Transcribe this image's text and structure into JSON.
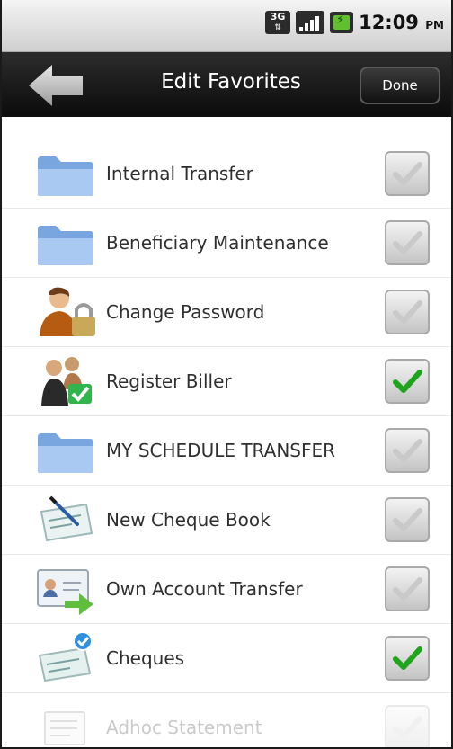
{
  "status": {
    "network": "3G",
    "time": "12:09",
    "ampm": "PM"
  },
  "header": {
    "title": "Edit Favorites",
    "done_label": "Done"
  },
  "items": [
    {
      "label": "Internal Transfer",
      "icon": "folder-icon",
      "checked": false
    },
    {
      "label": "Beneficiary Maintenance",
      "icon": "folder-icon",
      "checked": false
    },
    {
      "label": "Change Password",
      "icon": "user-lock-icon",
      "checked": false
    },
    {
      "label": "Register Biller",
      "icon": "register-biller-icon",
      "checked": true
    },
    {
      "label": "MY SCHEDULE TRANSFER",
      "icon": "folder-icon",
      "checked": false
    },
    {
      "label": "New Cheque Book",
      "icon": "cheque-book-icon",
      "checked": false
    },
    {
      "label": "Own Account Transfer",
      "icon": "account-transfer-icon",
      "checked": false
    },
    {
      "label": "Cheques",
      "icon": "cheques-icon",
      "checked": true
    },
    {
      "label": "Adhoc Statement",
      "icon": "statement-icon",
      "checked": false
    }
  ],
  "colors": {
    "title_bar": "#111111",
    "check_green": "#1fa51c",
    "check_grey": "#c9c9c9"
  }
}
